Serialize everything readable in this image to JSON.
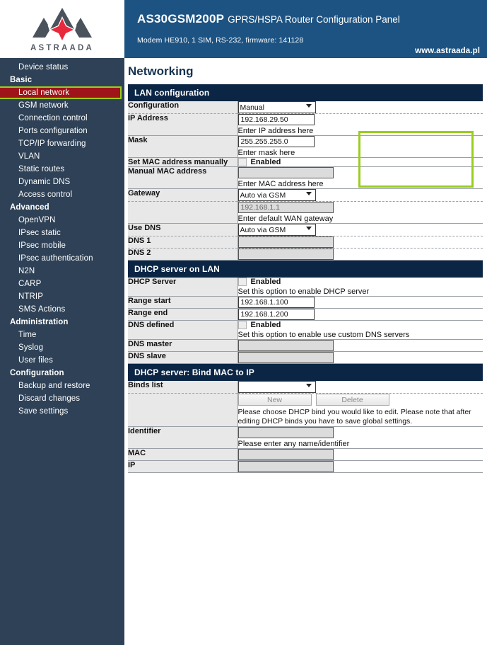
{
  "brand": {
    "logo_word": "ASTRAADA",
    "website": "www.astraada.pl"
  },
  "header": {
    "product": "AS30GSM200P",
    "product_subtitle": "GPRS/HSPA Router Configuration Panel",
    "modem_info": "Modem HE910, 1 SIM, RS-232, firmware: 141128"
  },
  "page": {
    "title": "Networking"
  },
  "sidebar": {
    "top_item": "Device status",
    "groups": [
      {
        "label": "Basic",
        "items": [
          "Local network",
          "GSM network",
          "Connection control",
          "Ports configuration",
          "TCP/IP forwarding",
          "VLAN",
          "Static routes",
          "Dynamic DNS",
          "Access control"
        ],
        "active": "Local network"
      },
      {
        "label": "Advanced",
        "items": [
          "OpenVPN",
          "IPsec static",
          "IPsec mobile",
          "IPsec authentication",
          "N2N",
          "CARP",
          "NTRIP",
          "SMS Actions"
        ],
        "active": null
      },
      {
        "label": "Administration",
        "items": [
          "Time",
          "Syslog",
          "User files"
        ],
        "active": null
      },
      {
        "label": "Configuration",
        "items": [
          "Backup and restore",
          "Discard changes",
          "Save settings"
        ],
        "active": null
      }
    ]
  },
  "colors": {
    "sidebar_bg": "#2e4156",
    "header_blue": "#1d5382",
    "section_navy": "#0b2545",
    "active_red": "#9e1418",
    "highlight_green": "#9acd1e",
    "label_gray": "#e8e8e8"
  },
  "sections": {
    "lan": {
      "title": "LAN configuration",
      "configuration_label": "Configuration",
      "configuration_value": "Manual",
      "configuration_options": [
        "Manual"
      ],
      "ip_label": "IP Address",
      "ip_value": "192.168.29.50",
      "ip_hint": "Enter IP address here",
      "mask_label": "Mask",
      "mask_value": "255.255.255.0",
      "mask_hint": "Enter mask here",
      "set_mac_label": "Set MAC address manually",
      "set_mac_checkbox_label": "Enabled",
      "manual_mac_label": "Manual MAC address",
      "manual_mac_value": "",
      "manual_mac_hint": "Enter MAC address here",
      "gateway_label": "Gateway",
      "gateway_value": "Auto via GSM",
      "gateway_options": [
        "Auto via GSM"
      ],
      "gateway_ip_value": "192.168.1.1",
      "gateway_ip_hint": "Enter default WAN gateway",
      "use_dns_label": "Use DNS",
      "use_dns_value": "Auto via GSM",
      "use_dns_options": [
        "Auto via GSM"
      ],
      "dns1_label": "DNS 1",
      "dns1_value": "",
      "dns2_label": "DNS 2",
      "dns2_value": ""
    },
    "dhcp": {
      "title": "DHCP server on LAN",
      "server_label": "DHCP Server",
      "server_checkbox_label": "Enabled",
      "server_hint": "Set this option to enable DHCP server",
      "range_start_label": "Range start",
      "range_start_value": "192.168.1.100",
      "range_end_label": "Range end",
      "range_end_value": "192.168.1.200",
      "dns_defined_label": "DNS defined",
      "dns_defined_checkbox_label": "Enabled",
      "dns_defined_hint": "Set this option to enable use custom DNS servers",
      "dns_master_label": "DNS master",
      "dns_master_value": "",
      "dns_slave_label": "DNS slave",
      "dns_slave_value": ""
    },
    "bind": {
      "title": "DHCP server: Bind MAC to IP",
      "binds_list_label": "Binds list",
      "binds_list_value": "",
      "binds_list_options": [],
      "new_button": "New",
      "delete_button": "Delete",
      "note": "Please choose DHCP bind you would like to edit. Please note that after editing DHCP binds you have to save global settings.",
      "identifier_label": "Identifier",
      "identifier_value": "",
      "identifier_hint": "Please enter any name/identifier",
      "mac_label": "MAC",
      "mac_value": "",
      "ip_label": "IP",
      "ip_value": ""
    }
  }
}
